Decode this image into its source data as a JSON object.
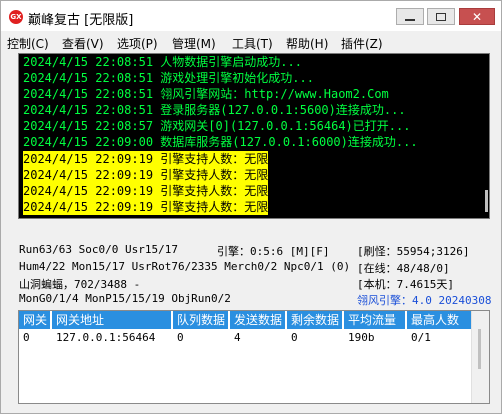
{
  "window": {
    "title": "巅峰复古 [无限版]",
    "icon_text": "GX",
    "icon_color": "#e02020"
  },
  "menu": [
    {
      "label": "控制(C)"
    },
    {
      "label": "查看(V)"
    },
    {
      "label": "选项(P)"
    },
    {
      "label": "管理(M)"
    },
    {
      "label": "工具(T)"
    },
    {
      "label": "帮助(H)"
    },
    {
      "label": "插件(Z)"
    }
  ],
  "log": {
    "text_color": "#00ff40",
    "highlight_color": "#ffff00",
    "lines": [
      {
        "time": "2024/4/15 22:08:51",
        "msg": "人物数据引擎启动成功..."
      },
      {
        "time": "2024/4/15 22:08:51",
        "msg": "游戏处理引擎初始化成功..."
      },
      {
        "time": "2024/4/15 22:08:51",
        "msg": "翎风引擎网站：http://www.Haom2.Com"
      },
      {
        "time": "2024/4/15 22:08:51",
        "msg": "登录服务器(127.0.0.1:5600)连接成功..."
      },
      {
        "time": "2024/4/15 22:08:57",
        "msg": "游戏网关[0](127.0.0.1:56464)已打开..."
      },
      {
        "time": "2024/4/15 22:09:00",
        "msg": "数据库服务器(127.0.0.1:6000)连接成功..."
      },
      {
        "time": "2024/4/15 22:09:19",
        "msg": "引擎支持人数：无限"
      },
      {
        "time": "2024/4/15 22:09:19",
        "msg": "引擎支持人数：无限"
      },
      {
        "time": "2024/4/15 22:09:19",
        "msg": "引擎支持人数：无限"
      },
      {
        "time": "2024/4/15 22:09:19",
        "msg": "引擎支持人数：无限"
      }
    ]
  },
  "stats": {
    "row1_left": "Run63/63 Soc0/0 Usr15/17",
    "row1_mid": "引擎：0:5:6 [M][F]",
    "row1_right": "[刷怪：55954;3126]",
    "row2_left": "Hum4/22 Mon15/17 UsrRot76/2335 Merch0/2 Npc0/1 (0)",
    "row2_right": "[在线：48/48/0]",
    "row3_left": "山洞蝙蝠，702/3488 -",
    "row3_right": "[本机：7.4615天]",
    "row4_left": "MonG0/1/4 MonP15/15/19 ObjRun0/2",
    "row4_right": "翎风引擎：4.0 20240308",
    "accent_color": "#1a4fd8"
  },
  "gateway_table": {
    "header_color": "#2a8fe0",
    "columns": [
      "网关",
      "网关地址",
      "队列数据",
      "发送数据",
      "剩余数据",
      "平均流量",
      "最高人数"
    ],
    "rows": [
      [
        "0",
        "127.0.0.1:56464",
        "0",
        "4",
        "0",
        "190b",
        "0/1"
      ]
    ]
  }
}
